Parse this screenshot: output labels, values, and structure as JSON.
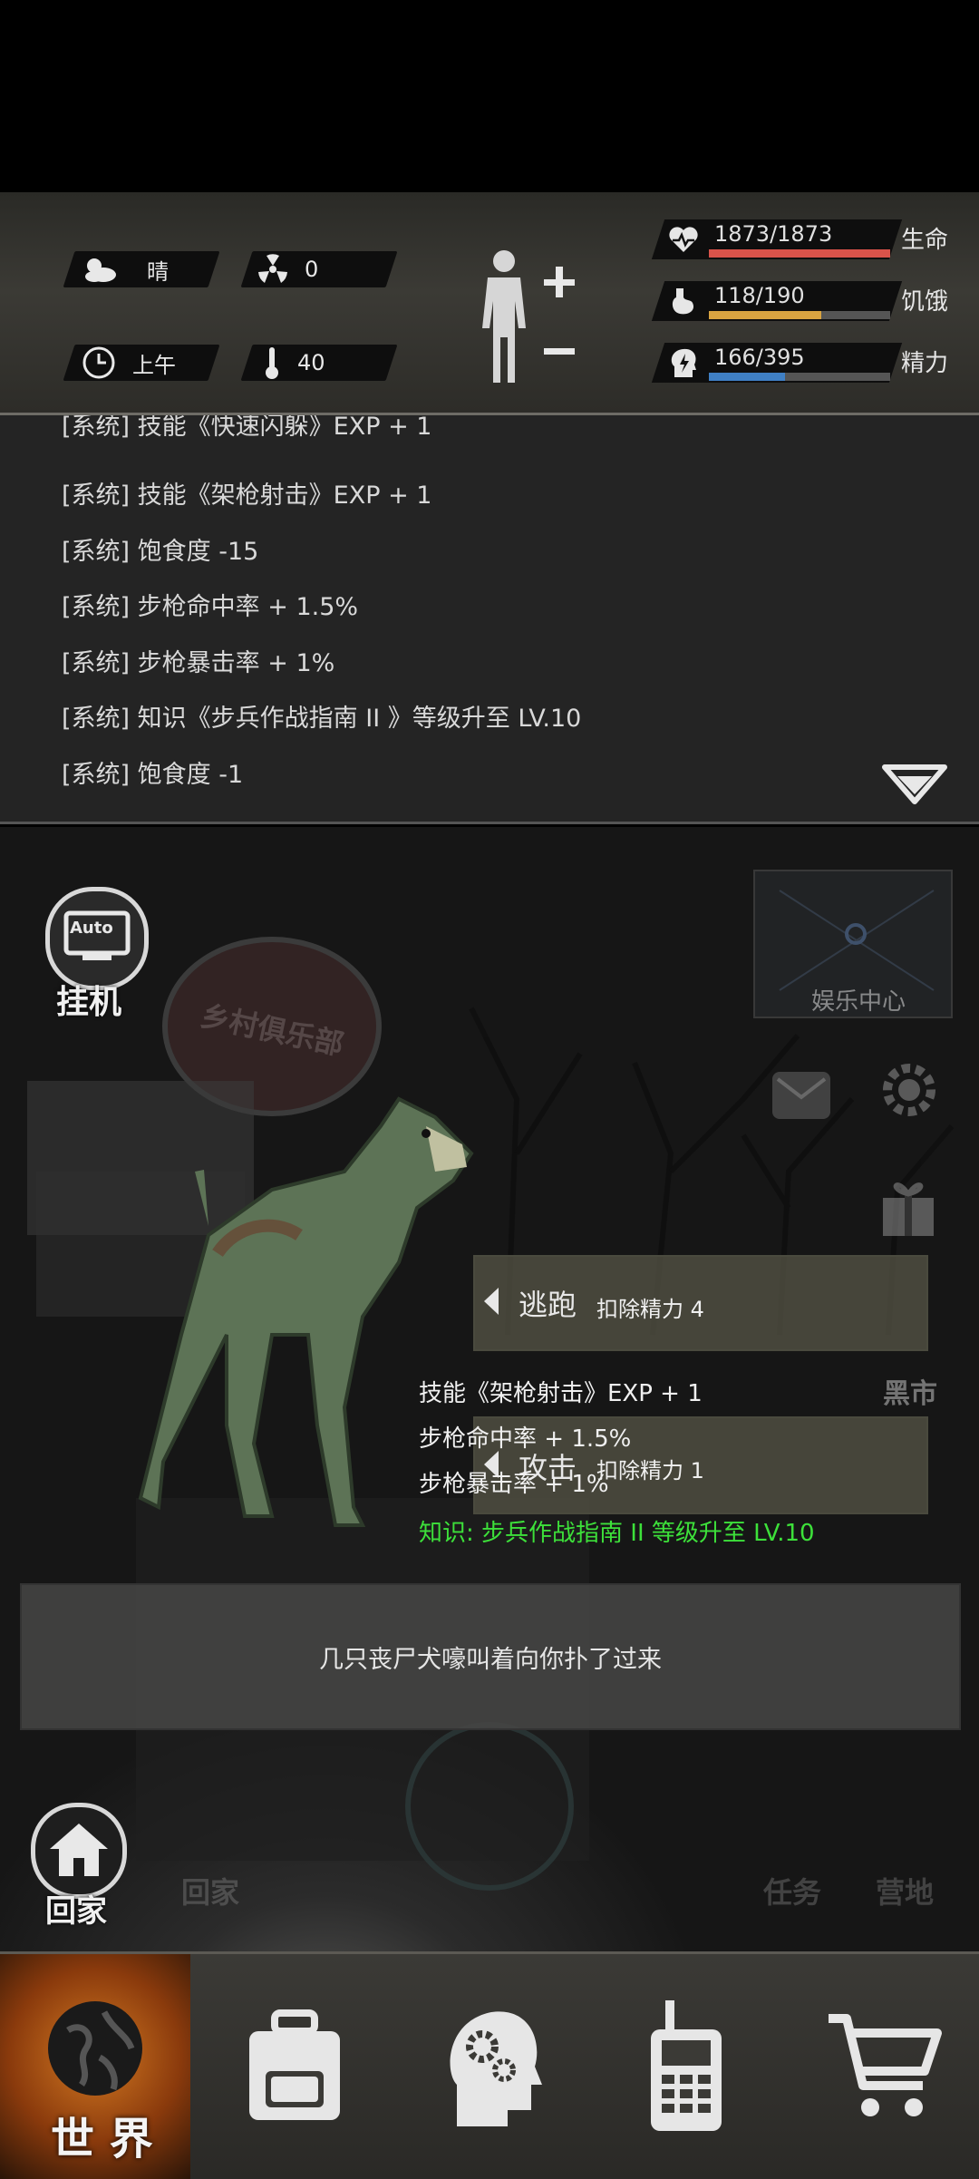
{
  "status": {
    "weather": "晴",
    "radiation": "0",
    "time_of_day": "上午",
    "temperature": "40",
    "health": {
      "value": "1873/1873",
      "label": "生命",
      "ratio": 1.0,
      "color": "#d9534a"
    },
    "hunger": {
      "value": "118/190",
      "label": "饥饿",
      "ratio": 0.62,
      "color": "#d9a441"
    },
    "energy": {
      "value": "166/395",
      "label": "精力",
      "ratio": 0.42,
      "color": "#3f7fc4"
    }
  },
  "log": {
    "partial_line": "[系统] 技能《快速闪躲》EXP + 1",
    "lines": [
      "[系统] 技能《架枪射击》EXP + 1",
      "[系统] 饱食度 -15",
      "[系统] 步枪命中率 + 1.5%",
      "[系统] 步枪暴击率 + 1%",
      "[系统] 知识《步兵作战指南 II 》等级升至 LV.10",
      "[系统] 饱食度 -1"
    ]
  },
  "scene": {
    "auto_label": "Auto",
    "afk_label": "挂机",
    "sign_text": "乡村俱乐部",
    "entertainment_label": "娱乐中心",
    "black_market_label": "黑市",
    "flee": {
      "label": "逃跑",
      "cost": "扣除精力 4"
    },
    "attack": {
      "label": "攻击",
      "cost": "扣除精力 1"
    },
    "combat_results": [
      "技能《架枪射击》EXP + 1",
      "步枪命中率 + 1.5%",
      "步枪暴击率 + 1%"
    ],
    "knowledge_result": "知识: 步兵作战指南 II  等级升至 LV.10",
    "message": "几只丧尸犬嚎叫着向你扑了过来",
    "home_label": "回家",
    "home_ghost_label": "回家",
    "task_label": "任务",
    "camp_label": "营地"
  },
  "nav": {
    "world_label": "世 界"
  },
  "colors": {
    "accent_green": "#3de03a",
    "nav_active": "#c0661a"
  }
}
